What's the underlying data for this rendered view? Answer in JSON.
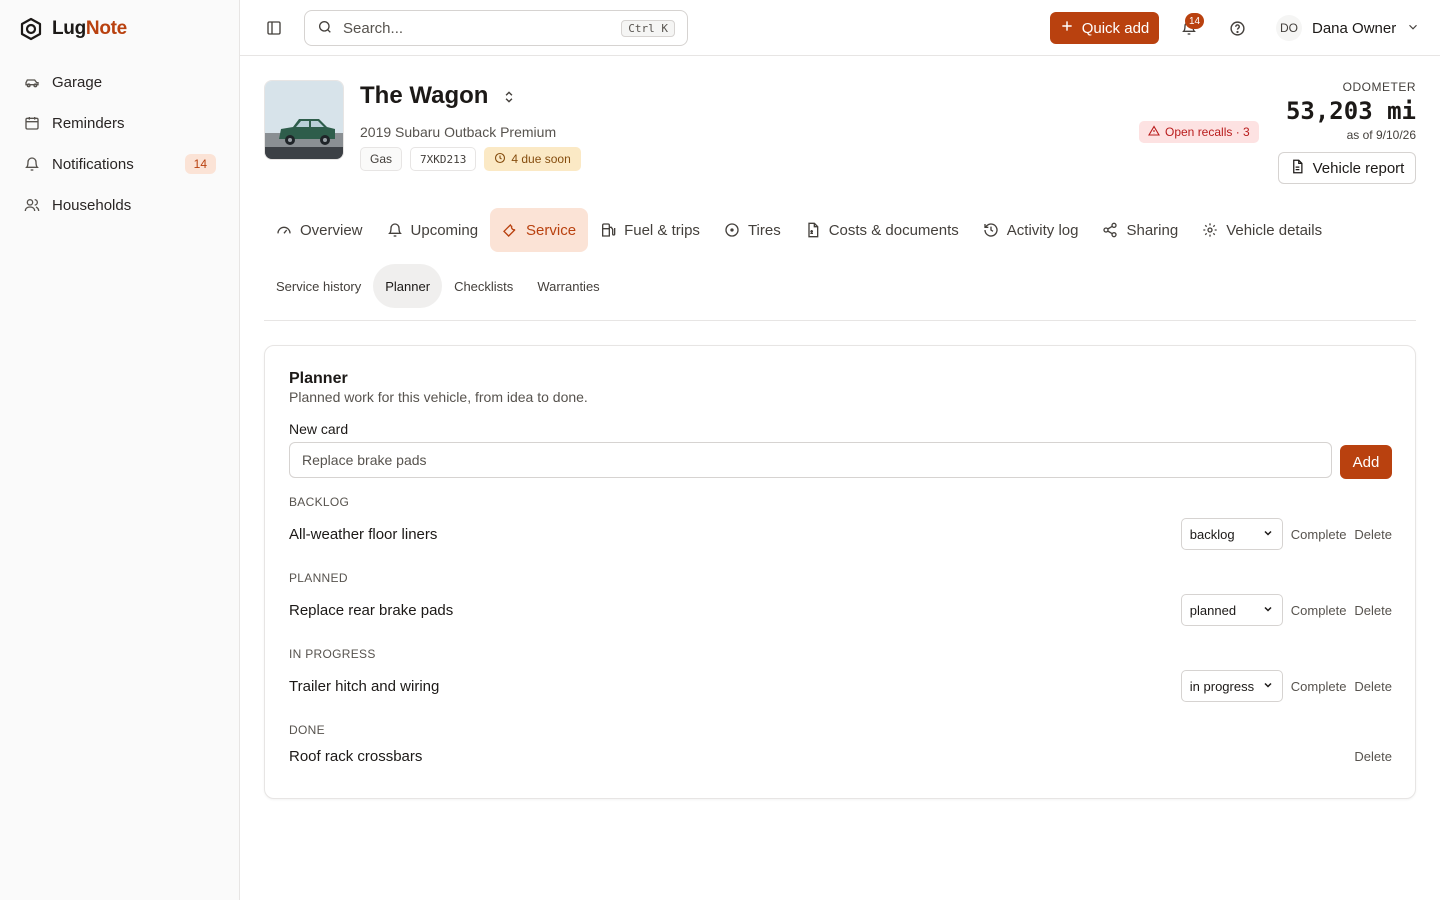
{
  "brand": {
    "part1": "Lug",
    "part2": "Note"
  },
  "sidebar": {
    "items": [
      {
        "label": "Garage",
        "icon": "car-icon"
      },
      {
        "label": "Reminders",
        "icon": "calendar-icon"
      },
      {
        "label": "Notifications",
        "icon": "bell-icon",
        "badge": "14"
      },
      {
        "label": "Households",
        "icon": "users-icon"
      }
    ]
  },
  "topbar": {
    "search_placeholder": "Search...",
    "search_shortcut": "Ctrl K",
    "quick_add_label": "Quick add",
    "notification_count": "14",
    "user_initials": "DO",
    "user_name": "Dana Owner"
  },
  "vehicle": {
    "name": "The Wagon",
    "description": "2019 Subaru Outback Premium",
    "fuel_tag": "Gas",
    "plate": "7XKD213",
    "due_tag": "4 due soon",
    "recall": "Open recalls · 3",
    "odometer_label": "ODOMETER",
    "odometer_value": "53,203 mi",
    "odometer_date": "as of 9/10/26",
    "report_label": "Vehicle report"
  },
  "tabs": [
    {
      "label": "Overview",
      "icon": "gauge-icon"
    },
    {
      "label": "Upcoming",
      "icon": "bell-icon"
    },
    {
      "label": "Service",
      "icon": "wrench-icon",
      "active": true
    },
    {
      "label": "Fuel & trips",
      "icon": "fuel-icon"
    },
    {
      "label": "Tires",
      "icon": "circle-icon"
    },
    {
      "label": "Costs & documents",
      "icon": "file-dollar-icon"
    },
    {
      "label": "Activity log",
      "icon": "history-icon"
    },
    {
      "label": "Sharing",
      "icon": "share-icon"
    },
    {
      "label": "Vehicle details",
      "icon": "gear-icon"
    }
  ],
  "subtabs": [
    {
      "label": "Service history"
    },
    {
      "label": "Planner",
      "active": true
    },
    {
      "label": "Checklists"
    },
    {
      "label": "Warranties"
    }
  ],
  "planner": {
    "title": "Planner",
    "subtitle": "Planned work for this vehicle, from idea to done.",
    "new_card_label": "New card",
    "new_card_placeholder": "Replace brake pads",
    "add_label": "Add",
    "complete_label": "Complete",
    "delete_label": "Delete",
    "sections": [
      {
        "heading": "BACKLOG",
        "item": "All-weather floor liners",
        "status": "backlog"
      },
      {
        "heading": "PLANNED",
        "item": "Replace rear brake pads",
        "status": "planned"
      },
      {
        "heading": "IN PROGRESS",
        "item": "Trailer hitch and wiring",
        "status": "in progress"
      },
      {
        "heading": "DONE",
        "item": "Roof rack crossbars",
        "status": ""
      }
    ]
  },
  "colors": {
    "accent": "#b9410f",
    "accent_soft": "#fbe3d6",
    "warning": "#fbe9c5",
    "danger": "#fde2e2"
  }
}
